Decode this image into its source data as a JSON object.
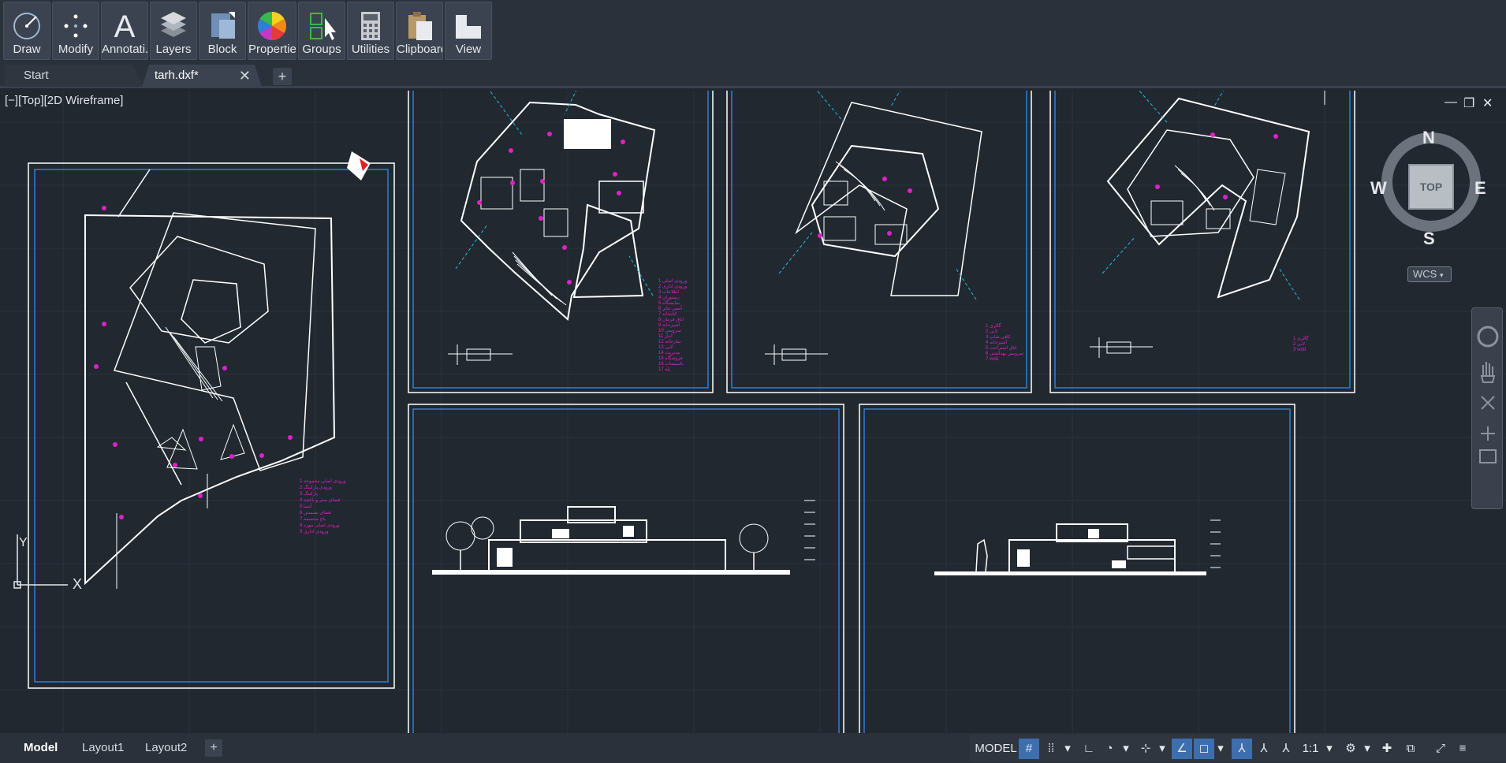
{
  "ribbon": {
    "buttons": [
      {
        "label": "Draw",
        "icon": "draw-arc-icon"
      },
      {
        "label": "Modify",
        "icon": "modify-move-icon"
      },
      {
        "label": "Annotati...",
        "icon": "text-A-icon"
      },
      {
        "label": "Layers",
        "icon": "layers-icon"
      },
      {
        "label": "Block",
        "icon": "block-insert-icon"
      },
      {
        "label": "Properties",
        "icon": "color-wheel-icon"
      },
      {
        "label": "Groups",
        "icon": "group-icon"
      },
      {
        "label": "Utilities",
        "icon": "calculator-icon"
      },
      {
        "label": "Clipboard",
        "icon": "clipboard-icon"
      },
      {
        "label": "View",
        "icon": "view-icon"
      }
    ]
  },
  "tabs": {
    "start_label": "Start",
    "file_label": "tarh.dxf*",
    "close_glyph": "✕",
    "new_glyph": "+"
  },
  "viewport": {
    "label": "[−][Top][2D Wireframe]",
    "window_controls": [
      "—",
      "❐",
      "✕"
    ]
  },
  "viewcube": {
    "top": "TOP",
    "north": "N",
    "south": "S",
    "east": "E",
    "west": "W",
    "wcs": "WCS"
  },
  "ucs": {
    "x_label": "X",
    "y_label": "Y"
  },
  "layout_tabs": [
    "Model",
    "Layout1",
    "Layout2"
  ],
  "layout_plus": "+",
  "statusbar": {
    "model": "MODEL",
    "scale": "1:1"
  },
  "colors": {
    "background": "#212830",
    "ribbon": "#2b313a",
    "linework": "#ffffff",
    "sheet_border": "#2f7fd6",
    "annotation": "#e020c8",
    "section_line": "#20c0d8",
    "selection": "#3d6fae"
  }
}
